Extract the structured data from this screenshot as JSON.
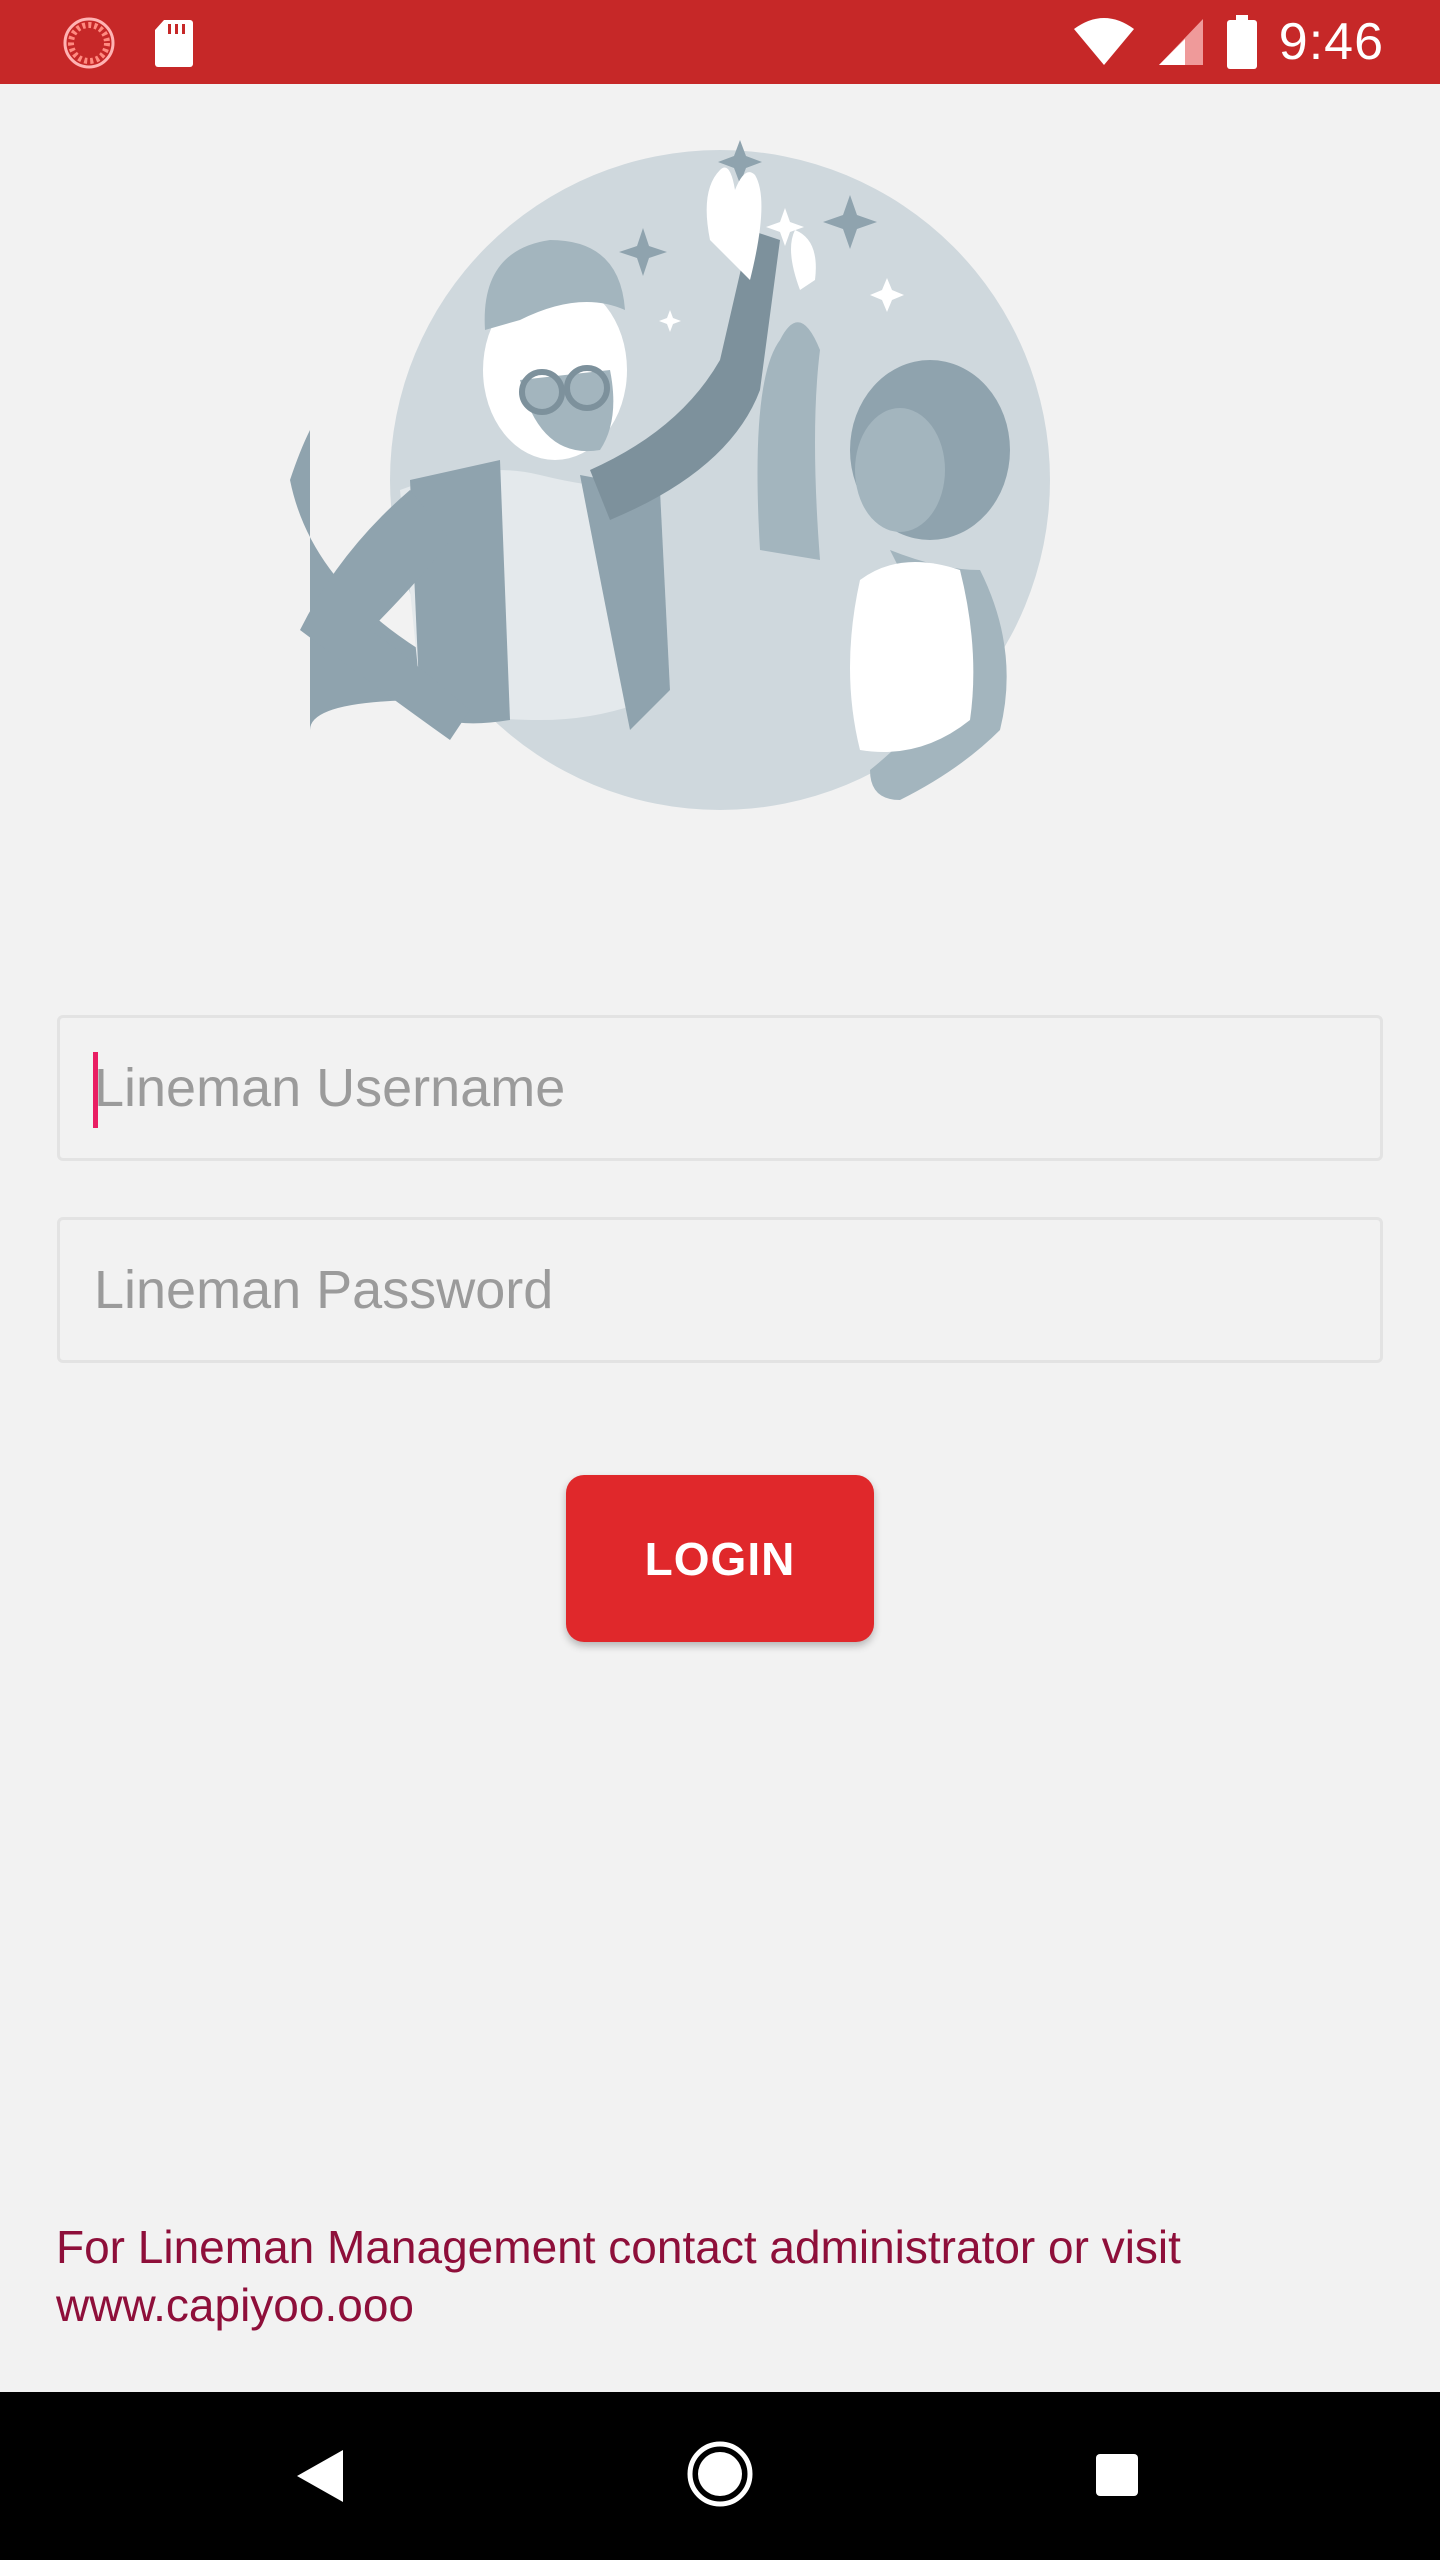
{
  "status_bar": {
    "time": "9:46",
    "icons": [
      "spinner-icon",
      "sd-card-icon",
      "wifi-icon",
      "cell-signal-icon",
      "battery-icon"
    ],
    "color": "#c62828"
  },
  "login_form": {
    "username_placeholder": "Lineman Username",
    "password_placeholder": "Lineman Password",
    "login_label": "LOGIN"
  },
  "footer": {
    "text": "For Lineman Management contact administrator or visit www.capiyoo.ooo"
  },
  "nav_bar": {
    "icons": [
      "back-icon",
      "home-icon",
      "recents-icon"
    ]
  },
  "colors": {
    "accent": "#e0282b",
    "footer_text": "#8e0f3a",
    "background": "#f2f2f2"
  }
}
